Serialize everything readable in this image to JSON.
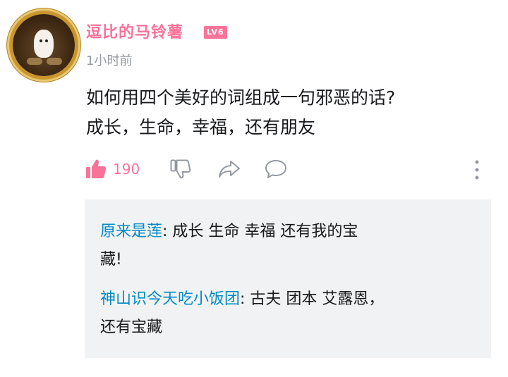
{
  "comment": {
    "username": "逗比的马铃薯",
    "level_badge": "LV6",
    "timestamp": "1小时前",
    "content_line1": "如何用四个美好的词组成一句邪恶的话?",
    "content_line2": "成长，生命，幸福，还有朋友",
    "like_count": "190",
    "icons": {
      "like": "thumbs-up-icon",
      "dislike": "thumbs-down-icon",
      "share": "share-arrow-icon",
      "reply": "comment-bubble-icon",
      "more": "more-vertical-icon"
    }
  },
  "replies": [
    {
      "name": "原来是莲",
      "text_line1": ": 成长 生命 幸福 还有我的宝",
      "text_line2": "藏!"
    },
    {
      "name": "神山识今天吃小饭团",
      "text_line1": ": 古夫 团本 艾露恩，",
      "text_line2": "还有宝藏"
    }
  ],
  "colors": {
    "accent_pink": "#fb7299",
    "reply_name_blue": "#008ac5",
    "muted_gray": "#9499a0",
    "reply_bg": "#f1f2f3"
  }
}
